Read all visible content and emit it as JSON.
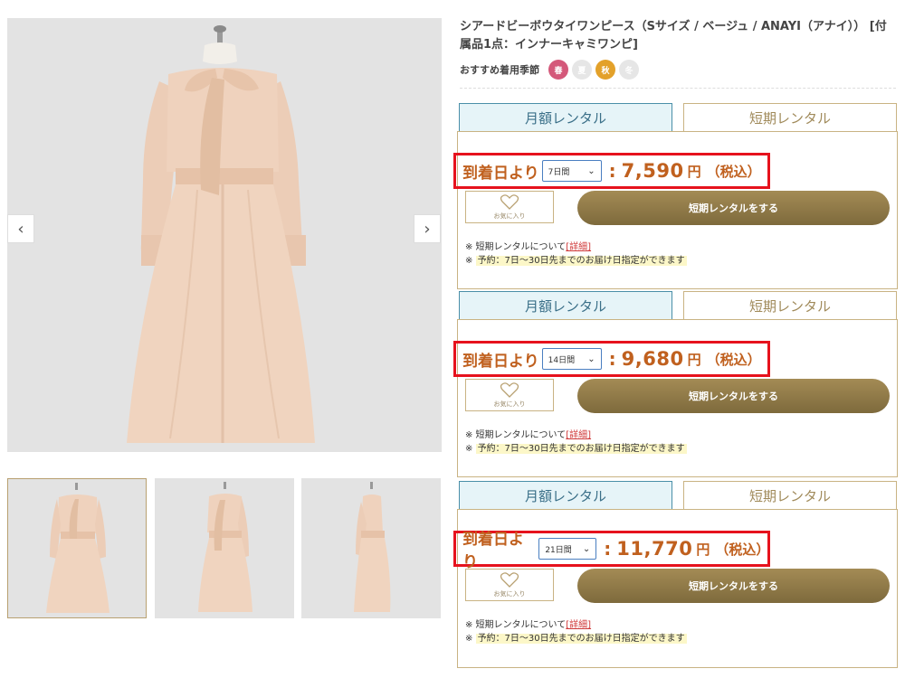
{
  "gallery": {
    "prev_arrow": "‹",
    "next_arrow": "›"
  },
  "product": {
    "title": "シアードビーボウタイワンピース（Sサイズ / ベージュ / ANAYI（アナイ）） [付属品1点：インナーキャミワンピ]"
  },
  "seasons": {
    "label": "おすすめ着用季節",
    "items": [
      {
        "label": "春",
        "active": true,
        "color": "#d4587a"
      },
      {
        "label": "夏",
        "active": false,
        "color": "#e6e6e6"
      },
      {
        "label": "秋",
        "active": true,
        "color": "#e3a12a"
      },
      {
        "label": "冬",
        "active": false,
        "color": "#e6e6e6"
      }
    ]
  },
  "rental_blocks": [
    {
      "tab_monthly": "月額レンタル",
      "tab_short": "短期レンタル",
      "price_prefix": "到着日より",
      "days": "7日間",
      "price": "7,590",
      "unit": "円",
      "tax": "（税込）",
      "fav_label": "お気に入り",
      "rent_button": "短期レンタルをする",
      "note1_text": "※ 短期レンタルについて",
      "note1_link": "[詳細]",
      "note2_prefix": "※ ",
      "note2_text": "予約：7日〜30日先までのお届け日指定ができます"
    },
    {
      "tab_monthly": "月額レンタル",
      "tab_short": "短期レンタル",
      "price_prefix": "到着日より",
      "days": "14日間",
      "price": "9,680",
      "unit": "円",
      "tax": "（税込）",
      "fav_label": "お気に入り",
      "rent_button": "短期レンタルをする",
      "note1_text": "※ 短期レンタルについて",
      "note1_link": "[詳細]",
      "note2_prefix": "※ ",
      "note2_text": "予約：7日〜30日先までのお届け日指定ができます"
    },
    {
      "tab_monthly": "月額レンタル",
      "tab_short": "短期レンタル",
      "price_prefix": "到着日より",
      "days": "21日間",
      "price": "11,770",
      "unit": "円",
      "tax": "（税込）",
      "fav_label": "お気に入り",
      "rent_button": "短期レンタルをする",
      "note1_text": "※ 短期レンタルについて",
      "note1_link": "[詳細]",
      "note2_prefix": "※ ",
      "note2_text": "予約：7日〜30日先までのお届け日指定ができます"
    }
  ],
  "colors": {
    "accent_price": "#c0601e",
    "highlight_border": "#e6121d",
    "gold": "#a48b55",
    "monthly_tab": "#e6f4f8"
  }
}
